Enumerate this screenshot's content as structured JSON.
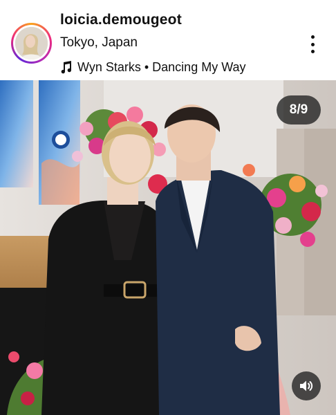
{
  "post": {
    "username": "loicia.demougeot",
    "location": "Tokyo, Japan",
    "music": "Wyn Starks • Dancing My Way",
    "counter": "8/9"
  },
  "icons": {
    "music": "music-note-icon",
    "more": "more-vertical-icon",
    "sound": "speaker-icon"
  }
}
